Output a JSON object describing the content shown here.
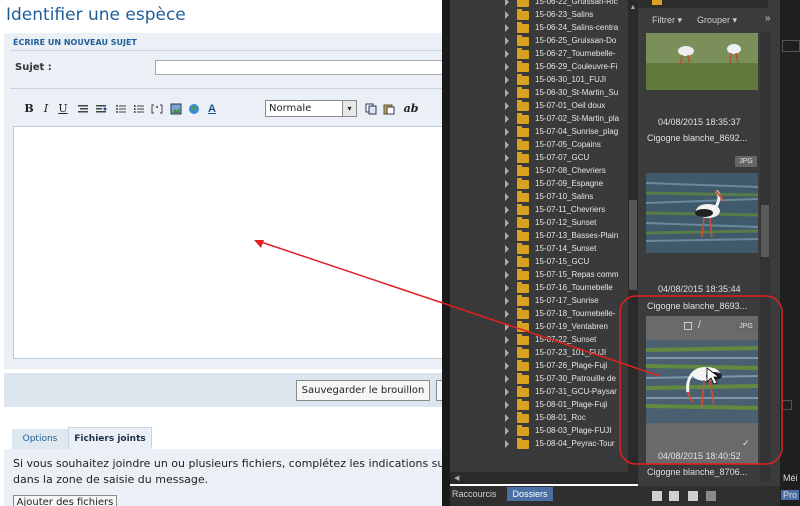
{
  "forum": {
    "page_title": "Identifier une espèce",
    "section_heading": "ÉCRIRE UN NOUVEAU SUJET",
    "subject_label": "Sujet :",
    "subject_value": "",
    "toolbar": {
      "bold": "B",
      "italic": "I",
      "underline": "U",
      "format_select": "Normale",
      "format_chevron": "▾",
      "spell": "ab"
    },
    "editor_value": "",
    "save_draft_button": "Sauvegarder le brouillon",
    "tabs": [
      "Options",
      "Fichiers joints"
    ],
    "attach_text_1": "Si vous souhaitez joindre un ou plusieurs fichiers, complétez les indications suiv",
    "attach_text_2": "dans la zone de saisie du message.",
    "add_files_button": "Ajouter des fichiers"
  },
  "file_manager": {
    "tree_items": [
      "15-06-22_Gruissan-Ric",
      "15-06-23_Salins",
      "15-06-24_Salins-centra",
      "15-06-25_Gruissan-Do",
      "15-06-27_Tournebelle-",
      "15-06-29_Couleuvre-Fi",
      "15-06-30_101_FUJI",
      "15-06-30_St-Martin_Su",
      "15-07-01_Oeil doux",
      "15-07-02_St-Martin_pla",
      "15-07-04_Sunrise_plag",
      "15-07-05_Copains",
      "15-07-07_GCU",
      "15-07-08_Chevriers",
      "15-07-09_Espagne",
      "15-07-10_Salins",
      "15-07-11_Chevriers",
      "15-07-12_Sunset",
      "15-07-13_Basses-Plain",
      "15-07-14_Sunset",
      "15-07-15_GCU",
      "15-07-15_Repas comm",
      "15-07-16_Tournebelle",
      "15-07-17_Sunrise",
      "15-07-18_Tournebelle-",
      "15-07-19_Ventabren",
      "15-07-22_Sunset",
      "15-07-23_101_FUJI",
      "15-07-26_Plage-Fuji",
      "15-07-30_Patrouille de",
      "15-07-31_GCU-Paysar",
      "15-08-01_Plage-Fuji",
      "15-08-01_Roc",
      "15-08-03_Plage-FUJI",
      "15-08-04_Peyrac-Tour"
    ],
    "tab_shortcuts": "Raccourcis",
    "tab_folders": "Dossiers",
    "filter_label": "Filtrer ▾",
    "group_label": "Grouper ▾",
    "more_label": "»",
    "thumbnails": [
      {
        "date": "04/08/2015 18:35:37",
        "name": "Cigogne blanche_8692...",
        "badge": ""
      },
      {
        "date": "04/08/2015 18:35:44",
        "name": "Cigogne blanche_8693...",
        "badge": "JPG"
      },
      {
        "date": "04/08/2015 18:40:52",
        "name": "Cigogne blanche_8706...",
        "badge": "JPG"
      }
    ],
    "right_panel_labels": [
      "Méi",
      "Pro"
    ]
  },
  "colors": {
    "annotation_red": "#e02020",
    "forum_title_blue": "#1f5e97",
    "folder_tab_blue": "#4a6fa5"
  }
}
